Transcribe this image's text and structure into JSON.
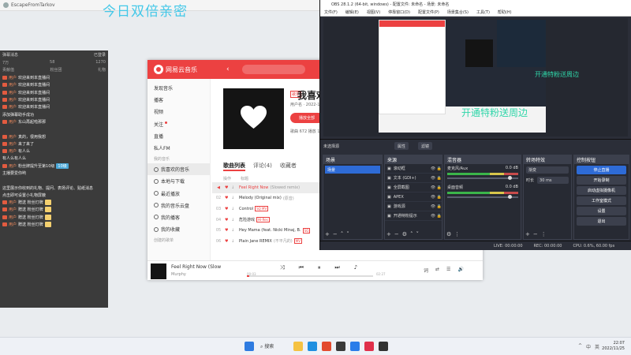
{
  "window": {
    "title": "EscapeFromTarkov",
    "banner": "今日双倍亲密"
  },
  "chat": {
    "header_left": "弹幕消息",
    "header_right": "已登录",
    "stats": [
      "7万",
      "58",
      "1270"
    ],
    "sub": [
      "贡献值",
      "粉丝团",
      "礼物"
    ],
    "messages": [
      {
        "name": "用户",
        "text": "欢迎来到本直播间"
      },
      {
        "name": "用户",
        "text": "欢迎来到本直播间"
      },
      {
        "name": "用户",
        "text": "欢迎来到本直播间"
      },
      {
        "name": "用户",
        "text": "欢迎来到本直播间"
      },
      {
        "name": "用户",
        "text": "欢迎来到本直播间"
      },
      {
        "name": "",
        "text": "添加弹幕助手成功"
      },
      {
        "name": "用户",
        "text": "东山再起啦那那"
      },
      {
        "name": "",
        "text": ""
      },
      {
        "name": "用户",
        "text": "真的，很用我想"
      },
      {
        "name": "用户",
        "text": "来了来了"
      },
      {
        "name": "用户",
        "text": "有人么"
      },
      {
        "name": "",
        "text": "有人么有人么"
      },
      {
        "name": "用户",
        "text": "粉丝牌提升至第10级"
      },
      {
        "name": "",
        "text": "主播要爱你哟"
      },
      {
        "name": "",
        "text": ""
      },
      {
        "name": "",
        "text": "这里展示你收到的礼物、提问、表扬评论、贴纸消息"
      },
      {
        "name": "",
        "text": "点击即可设置小礼物屏蔽"
      },
      {
        "name": "用户",
        "text": "赠送 粉丝灯牌"
      },
      {
        "name": "用户",
        "text": "赠送 粉丝灯牌"
      },
      {
        "name": "用户",
        "text": "赠送 粉丝灯牌"
      },
      {
        "name": "用户",
        "text": "赠送 粉丝灯牌"
      }
    ],
    "vip_label": "10级"
  },
  "music": {
    "app_title": "网易云音乐",
    "sidebar": [
      "发现音乐",
      "播客",
      "视频",
      "关注",
      "直播",
      "私人FM"
    ],
    "section_mine": "我的音乐",
    "my_items": [
      "我喜欢的音乐",
      "本地与下载",
      "最近播放",
      "我的音乐云盘",
      "我的播客",
      "我的收藏"
    ],
    "section_playlists": "创建的歌单",
    "playlist": {
      "tag": "歌单",
      "name": "我喜欢",
      "owner": "用户名 · 2022-11",
      "play_all": "播放全部",
      "stats": "歌曲 672  播放 1,334"
    },
    "tabs": [
      "歌曲列表",
      "评论(4)",
      "收藏者"
    ],
    "table_header": [
      "操作",
      "标题"
    ],
    "tracks": [
      {
        "n": "01",
        "title": "Feel Right Now",
        "sub": "(Slowed remix)",
        "tag": "",
        "playing": true
      },
      {
        "n": "02",
        "title": "Melody (Original mix)",
        "sub": "(原音)",
        "tag": ""
      },
      {
        "n": "03",
        "title": "Control",
        "sub": "",
        "tag": "SQ MV"
      },
      {
        "n": "04",
        "title": "危险游戏",
        "sub": "",
        "tag": "Hi-Res"
      },
      {
        "n": "05",
        "title": "Hey Mama (feat. Nicki Minaj, B.",
        "sub": "",
        "tag": "SQ"
      },
      {
        "n": "06",
        "title": "Plain Jane REMIX",
        "sub": "(不平凡的)",
        "tag": "MV"
      }
    ],
    "player": {
      "title": "Feel Right Now (Slow",
      "artist": "Murphy",
      "time_current": "00:03",
      "time_total": "02:27",
      "progress": 0.02,
      "controls": [
        "⤨",
        "⏮",
        "⏸",
        "⏭",
        "♪"
      ],
      "right": [
        "词",
        "⇄",
        "☰",
        "🔊"
      ]
    }
  },
  "obs": {
    "title": "OBS 28.1.2 (64-bit, windows) - 配置文件: 未命名 - 场景: 未命名",
    "menu": [
      "文件(F)",
      "编辑(E)",
      "视图(V)",
      "停靠窗口(D)",
      "配置文件(P)",
      "场景集合(S)",
      "工具(T)",
      "帮助(H)"
    ],
    "preview_text_big": "开通特粉送周边",
    "preview_text_small": "开通特粉送周边",
    "no_source": "未选择源",
    "strip_buttons": [
      "属性",
      "滤镜"
    ],
    "docks": {
      "scenes": {
        "title": "场景",
        "items": [
          "场景"
        ]
      },
      "sources": {
        "title": "来源",
        "items": [
          "滚动框",
          "文本 (GDI+)",
          "全屏截图",
          "APEX",
          "游戏源",
          "开通特粉提示"
        ]
      },
      "mixer": {
        "title": "混音器",
        "channels": [
          {
            "name": "麦克风/Aux",
            "db": "0.0 dB"
          },
          {
            "name": "桌面音频",
            "db": "0.0 dB"
          }
        ]
      },
      "transitions": {
        "title": "转场特效",
        "type": "渐变",
        "duration_label": "时长",
        "duration": "30 ms"
      },
      "controls": {
        "title": "控制按钮",
        "buttons": [
          "停止直播",
          "开始录制",
          "启动虚拟摄像机",
          "工作室模式",
          "设置",
          "退出"
        ]
      }
    },
    "status": {
      "live": "LIVE: 00:00:00",
      "rec": "REC: 00:00:00",
      "cpu": "CPU: 0.6%, 60.00 fps"
    }
  },
  "taskbar": {
    "search": "搜索",
    "time": "22:07",
    "date": "2022/11/25",
    "tray": [
      "^",
      "中",
      "英"
    ]
  }
}
